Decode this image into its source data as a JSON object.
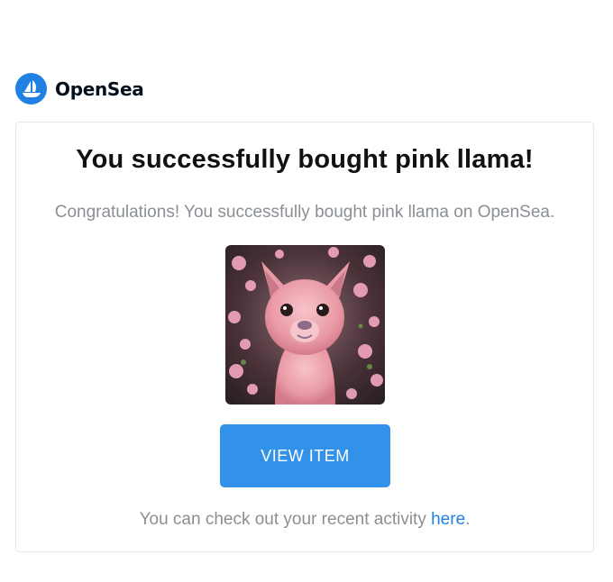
{
  "brand": {
    "name": "OpenSea",
    "logo_icon": "opensea-ship-icon",
    "color": "#2081e2"
  },
  "email": {
    "headline": "You successfully bought pink llama!",
    "message": "Congratulations! You successfully bought pink llama on OpenSea.",
    "item_image": "pink-llama-artwork",
    "button_label": "VIEW ITEM",
    "button_color": "#3291e9",
    "footer_prefix": "You can check out your recent activity ",
    "footer_link": "here",
    "footer_suffix": "."
  }
}
